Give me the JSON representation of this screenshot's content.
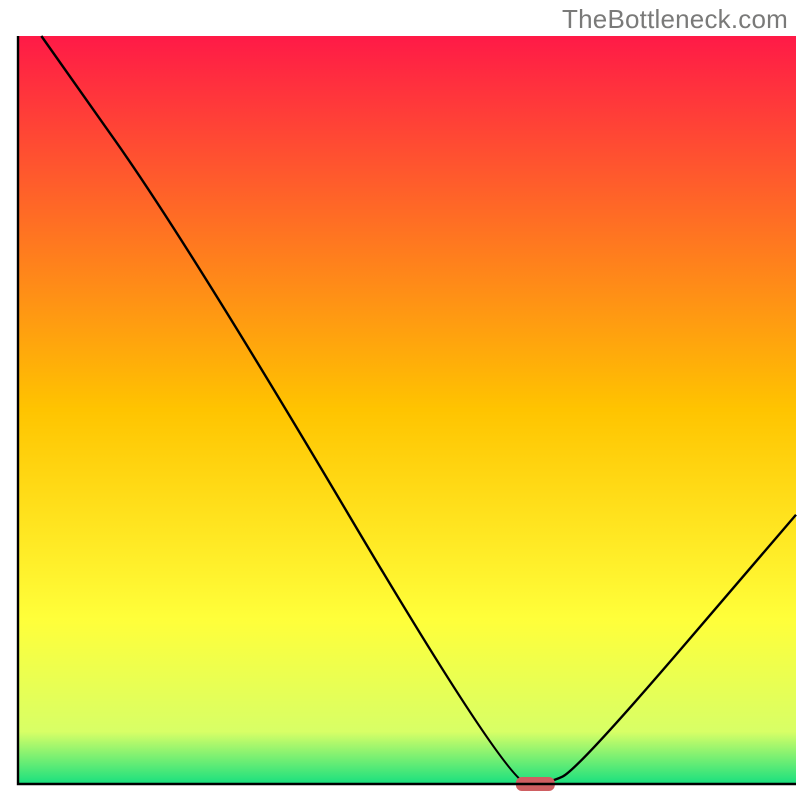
{
  "watermark": "TheBottleneck.com",
  "chart_data": {
    "type": "line",
    "title": "",
    "xlabel": "",
    "ylabel": "",
    "xlim": [
      0,
      100
    ],
    "ylim": [
      0,
      100
    ],
    "grid": false,
    "x": [
      3,
      22,
      63,
      68,
      72,
      100
    ],
    "values": [
      100,
      72,
      0,
      0,
      2,
      36
    ],
    "marker": {
      "x_start": 64,
      "x_end": 69,
      "y": 0
    },
    "background_gradient": {
      "type": "vertical",
      "stops": [
        {
          "pos": 0,
          "color": "#ff1a47"
        },
        {
          "pos": 0.5,
          "color": "#ffc400"
        },
        {
          "pos": 0.78,
          "color": "#ffff3a"
        },
        {
          "pos": 0.93,
          "color": "#d8ff66"
        },
        {
          "pos": 1.0,
          "color": "#18e07f"
        }
      ]
    },
    "axis_color": "#000000",
    "line_color": "#000000",
    "marker_color": "#cf5f62"
  }
}
